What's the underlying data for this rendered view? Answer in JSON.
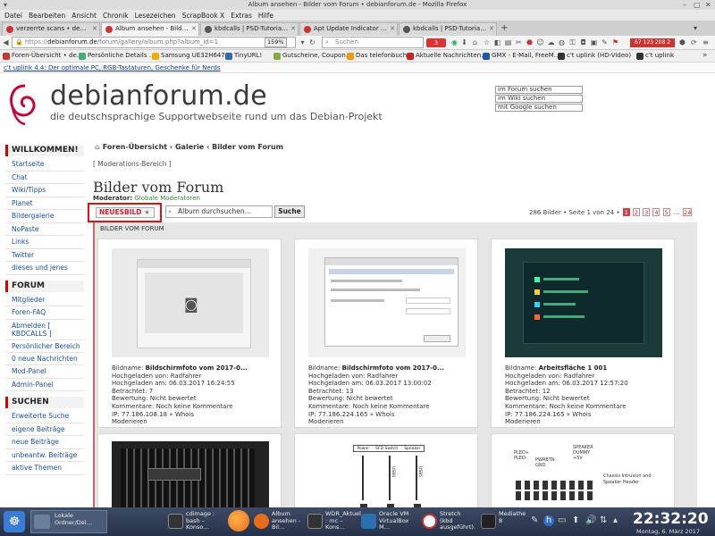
{
  "window": {
    "title": "Album ansehen - Bilder vom Forum • debianforum.de - Mozilla Firefox"
  },
  "menu": [
    "Datei",
    "Bearbeiten",
    "Ansicht",
    "Chronik",
    "Lesezeichen",
    "ScrapBook X",
    "Extras",
    "Hilfe"
  ],
  "tabs": [
    {
      "label": "verzerrte scans • de…",
      "color": "#c33"
    },
    {
      "label": "Album ansehen - Bild…",
      "color": "#c33",
      "active": true
    },
    {
      "label": "kbdcalls | PSD-Tutoria…",
      "color": "#555"
    },
    {
      "label": "Apt Update Indicator …",
      "color": "#c33"
    },
    {
      "label": "kbdcalls | PSD-Tutoria…",
      "color": "#555"
    }
  ],
  "nav": {
    "url_host": "debianforum.de",
    "url_prefix": "https://",
    "url_path": "/forum/gallery/album.php?album_id=1",
    "zoom": "159%",
    "search_placeholder": "Suchen",
    "badge1": "3",
    "badge2": "67 123 208 2"
  },
  "bookmarks": [
    {
      "label": "Foren-Übersicht • de…",
      "color": "#c33"
    },
    {
      "label": "Persönliche Details …",
      "color": "#4a7"
    },
    {
      "label": "Samsung UE32H647…",
      "color": "#fa0"
    },
    {
      "label": "TinyURL!",
      "color": "#36a"
    },
    {
      "label": "Gutscheine, Coupon…",
      "color": "#8a4"
    },
    {
      "label": "Das telefonbuch",
      "color": "#e91"
    },
    {
      "label": "Aktuelle Nachrichten…",
      "color": "#c22"
    },
    {
      "label": "GMX - E-Mail, FreeM…",
      "color": "#25a"
    },
    {
      "label": "c't uplink (HD-Video)",
      "color": "#333"
    },
    {
      "label": "c't uplink",
      "color": "#333"
    }
  ],
  "message_bar": "c't uplink 4.4: Der optimale PC, RGB-Tastaturen, Geschenke für Nerds",
  "site": {
    "title": "debianforum.de",
    "subtitle": "die deutschsprachige Supportwebseite rund um das Debian-Projekt",
    "search_boxes": [
      "im Forum suchen",
      "im Wiki suchen",
      "mit Google suchen"
    ]
  },
  "sidebar": {
    "welcome_title": "WILLKOMMEN!",
    "welcome_links": [
      "Startseite",
      "Chat",
      "Wiki/Tipps",
      "Planet",
      "Bildergalerie",
      "NoPaste",
      "Links",
      "Twitter",
      "dieses und jenes"
    ],
    "forum_title": "FORUM",
    "forum_links": [
      "Mitglieder",
      "Foren-FAQ",
      "Abmelden [ KBDCALLS ]",
      "Persönlicher Bereich",
      "0 neue Nachrichten",
      "Mod-Panel",
      "Admin-Panel"
    ],
    "search_title": "SUCHEN",
    "search_links": [
      "Erweiterte Suche",
      "eigene Beiträge",
      "neue Beiträge",
      "unbeantw. Beiträge",
      "aktive Themen"
    ]
  },
  "main": {
    "breadcrumb": "Foren-Übersicht ‹ Galerie ‹ Bilder vom Forum",
    "mod_link": "[ Moderations-Bereich ]",
    "title": "Bilder vom Forum",
    "moderator_label": "Moderator:",
    "moderator": "Globale Moderatoren",
    "new_image": "NEUESBILD",
    "album_search_placeholder": "Album durchsuchen…",
    "search_button": "Suche",
    "pagination_text": "286 Bilder • Seite 1 von 24 •",
    "pages": [
      "1",
      "2",
      "3",
      "4",
      "5",
      "…",
      "24"
    ],
    "album_heading": "BILDER VOM FORUM"
  },
  "cards": [
    {
      "name": "Bildschirmfoto vom 2017-0...",
      "uploader": "Radfahrer",
      "uploaded": "06.03.2017 16:24:55",
      "views": "7",
      "rating": "Nicht bewertet",
      "comments": "Noch keine Kommentare",
      "ip": "IP: 77.186.108.18 » Whois",
      "moderate": "Moderieren",
      "icon": "camera-icon"
    },
    {
      "name": "Bildschirmfoto vom 2017-0...",
      "uploader": "Radfahrer",
      "uploaded": "06.03.2017 13:00:02",
      "views": "13",
      "rating": "Nicht bewertet",
      "comments": "Noch keine Kommentare",
      "ip": "IP: 77.186.224.165 » Whois",
      "moderate": "Moderieren",
      "icon": "settings-dialog-icon"
    },
    {
      "name": "Arbeitsfläche 1 001",
      "uploader": "Radfahrer",
      "uploaded": "06.03.2017 12:57:20",
      "views": "12",
      "rating": "Nicht bewertet",
      "comments": "Noch keine Kommentare",
      "ip": "IP: 77.186.224.165 » Whois",
      "moderate": "Moderieren",
      "icon": "desktop-icon"
    }
  ],
  "labels": {
    "name": "Bildname:",
    "uploader": "Hochgeladen von:",
    "uploaded": "Hochgeladen am:",
    "views": "Betrachtet:",
    "rating": "Bewertung:",
    "comments": "Kommentare:"
  },
  "row2_thumbs": {
    "circuit_texts": [
      "Power",
      "SFD Switch",
      "Speaker",
      "USB4",
      "USB5"
    ],
    "chassis_texts": [
      "PLED+",
      "PLED-",
      "PWRBTN",
      "GND",
      "SPEAKER",
      "DUMMY",
      "+5V",
      "Chassis Intrusion and",
      "Speaker Header"
    ]
  },
  "taskbar": {
    "tasks": [
      {
        "label": "Lokale Ordner/Del…",
        "color": "#6a7f99"
      },
      {
        "label": "cdimage : bash – Konso…",
        "color": "#333"
      },
      {
        "label": "",
        "color": "#e96b1c"
      },
      {
        "label": "Album ansehen - Bil…",
        "color": "#e96b1c"
      },
      {
        "label": "WDR_Aktuell : mc – Kons…",
        "color": "#333"
      },
      {
        "label": "Oracle VM VirtualBox M…",
        "color": "#2a6fb0"
      },
      {
        "label": "Stretch (kbd ausgeführt)…",
        "color": "#c33"
      },
      {
        "label": "Mediathek 8",
        "color": "#222"
      }
    ],
    "clock": "22:32:20",
    "date": "Montag, 6. März 2017"
  }
}
